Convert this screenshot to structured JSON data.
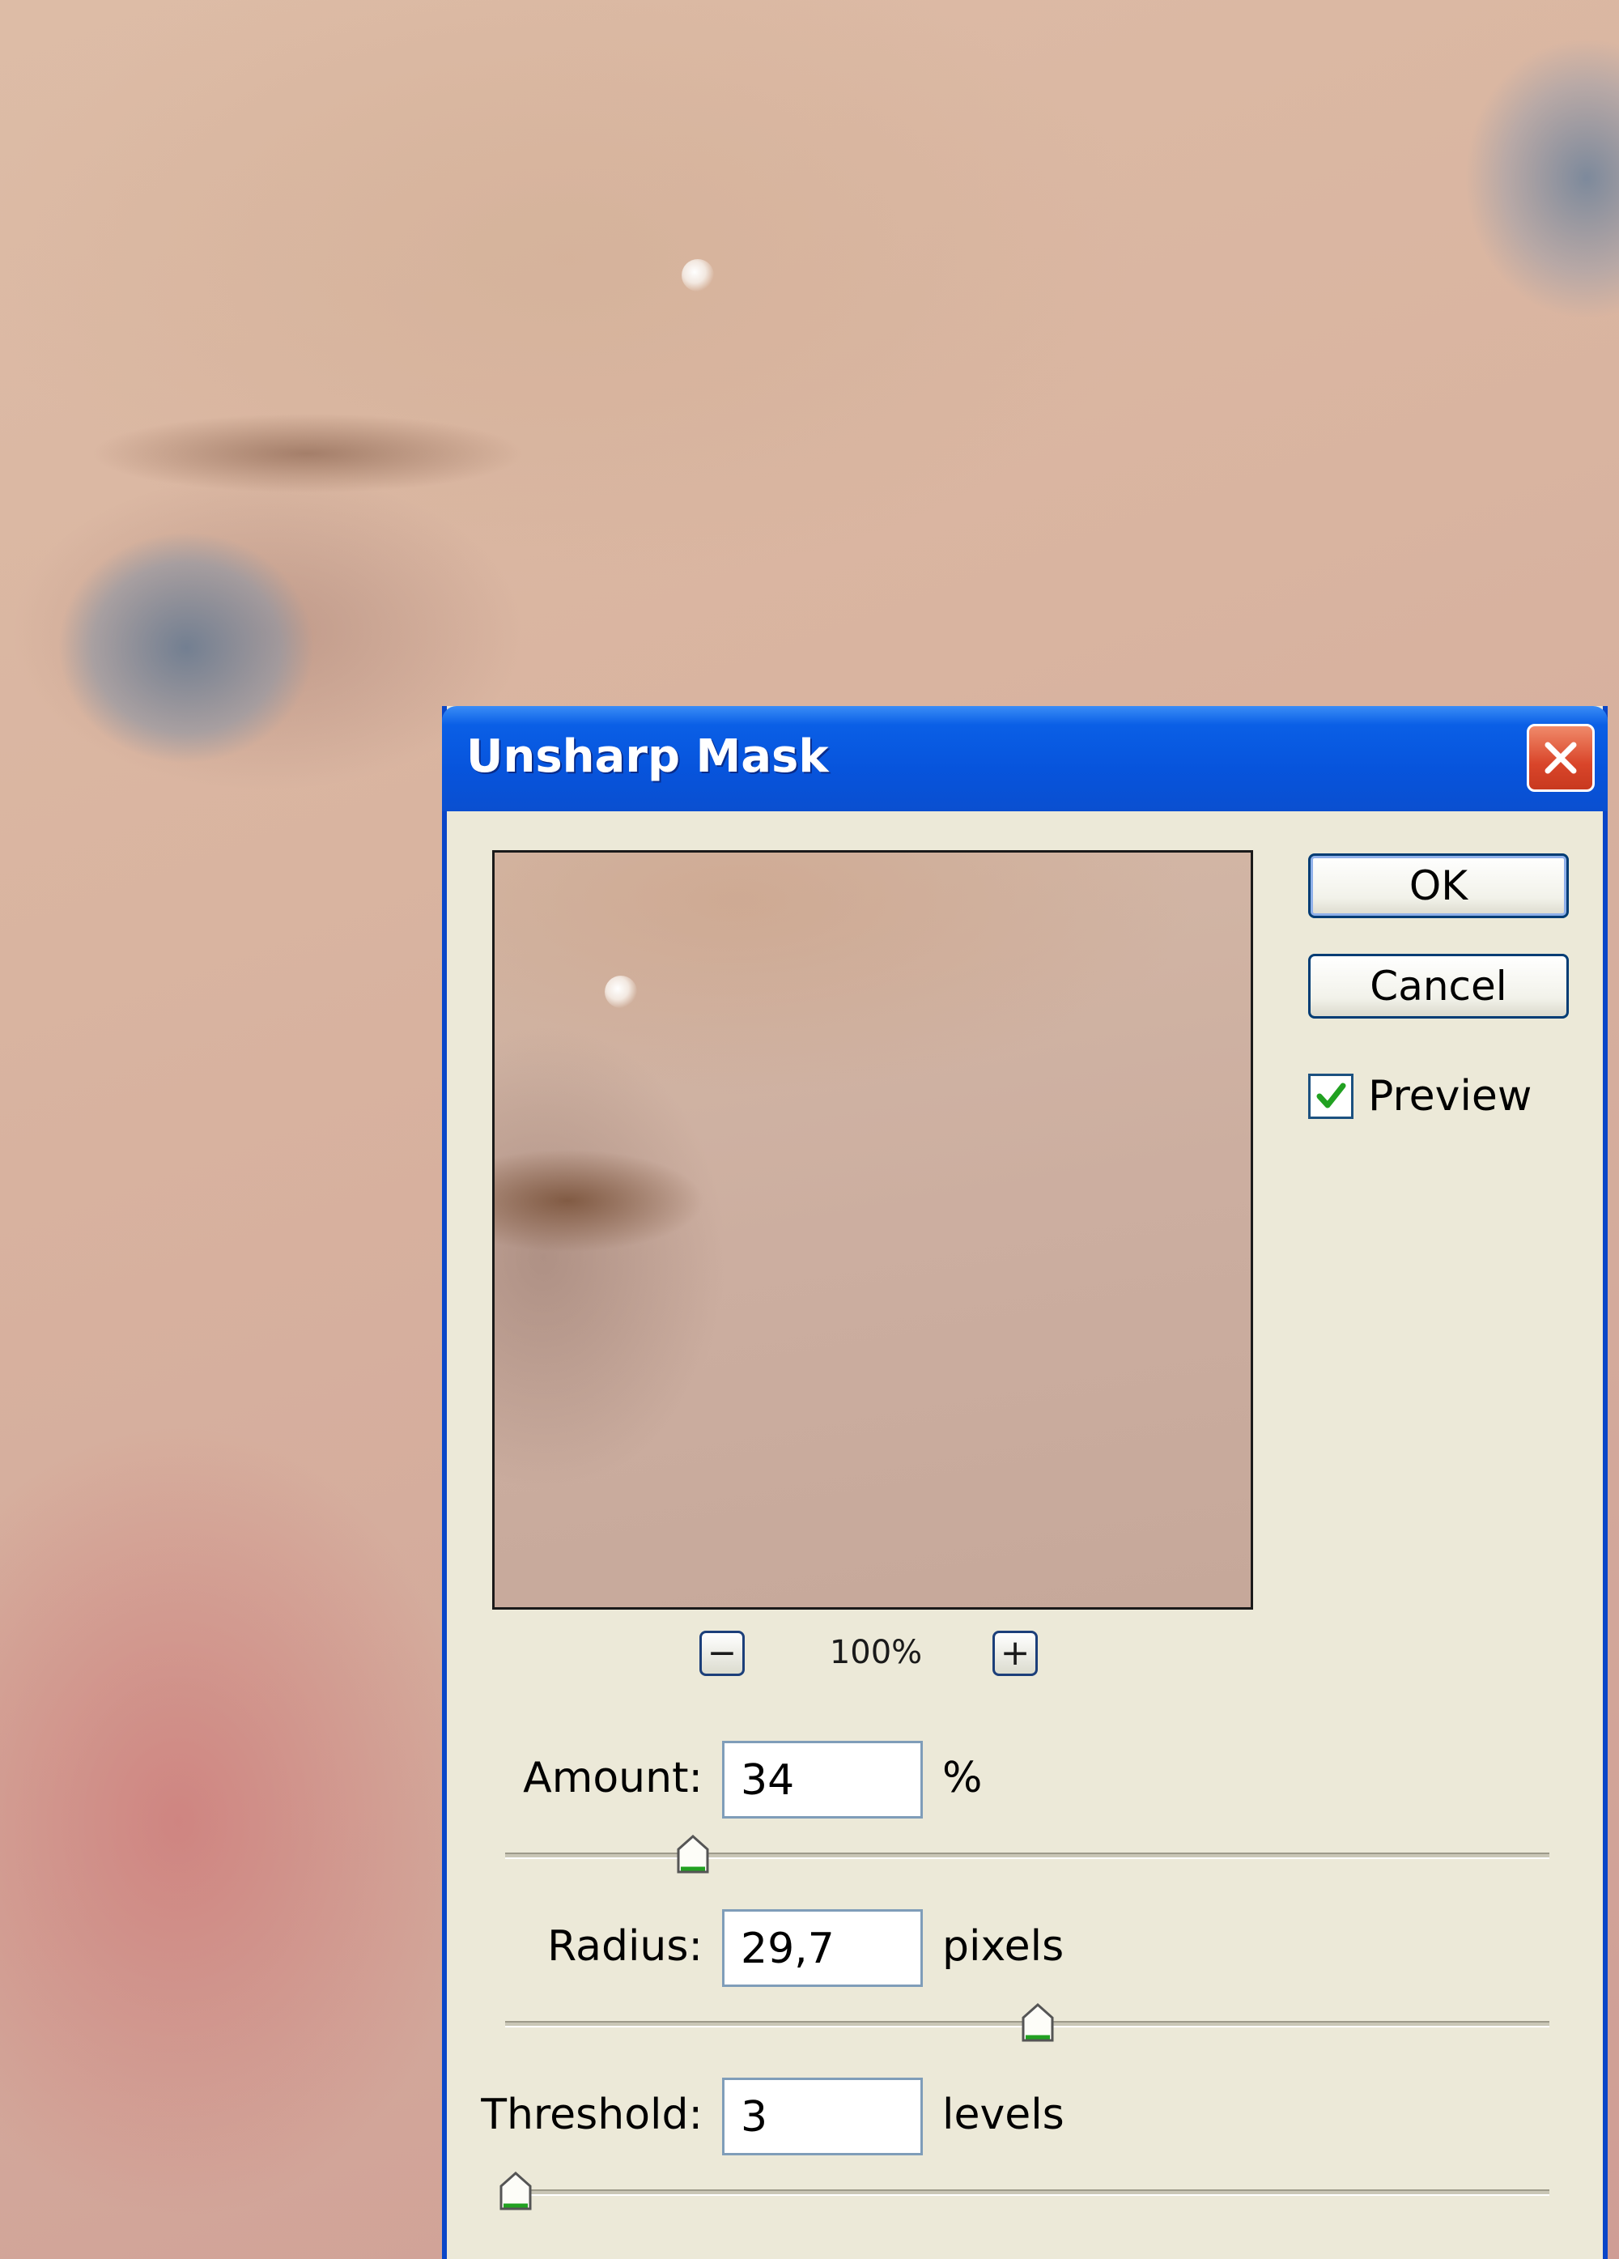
{
  "dialog": {
    "title": "Unsharp Mask",
    "ok_label": "OK",
    "cancel_label": "Cancel",
    "preview_label": "Preview",
    "preview_checked": true,
    "zoom": {
      "level": "100%",
      "minus_symbol": "−",
      "plus_symbol": "+"
    },
    "amount": {
      "label": "Amount:",
      "value": "34",
      "unit": "%",
      "slider_fraction": 0.18
    },
    "radius": {
      "label": "Radius:",
      "value": "29,7",
      "unit": "pixels",
      "slider_fraction": 0.51
    },
    "threshold": {
      "label": "Threshold:",
      "value": "3",
      "unit": "levels",
      "slider_fraction": 0.01
    }
  },
  "colors": {
    "titlebar": "#0754dc",
    "dialog_bg": "#ece9d8",
    "close_button": "#d9452a",
    "checkmark": "#21a121",
    "slider_thumb_accent": "#21a121"
  },
  "icons": {
    "close": "close-x-icon",
    "checkbox": "checkmark-icon",
    "slider_thumb": "slider-thumb-icon"
  }
}
